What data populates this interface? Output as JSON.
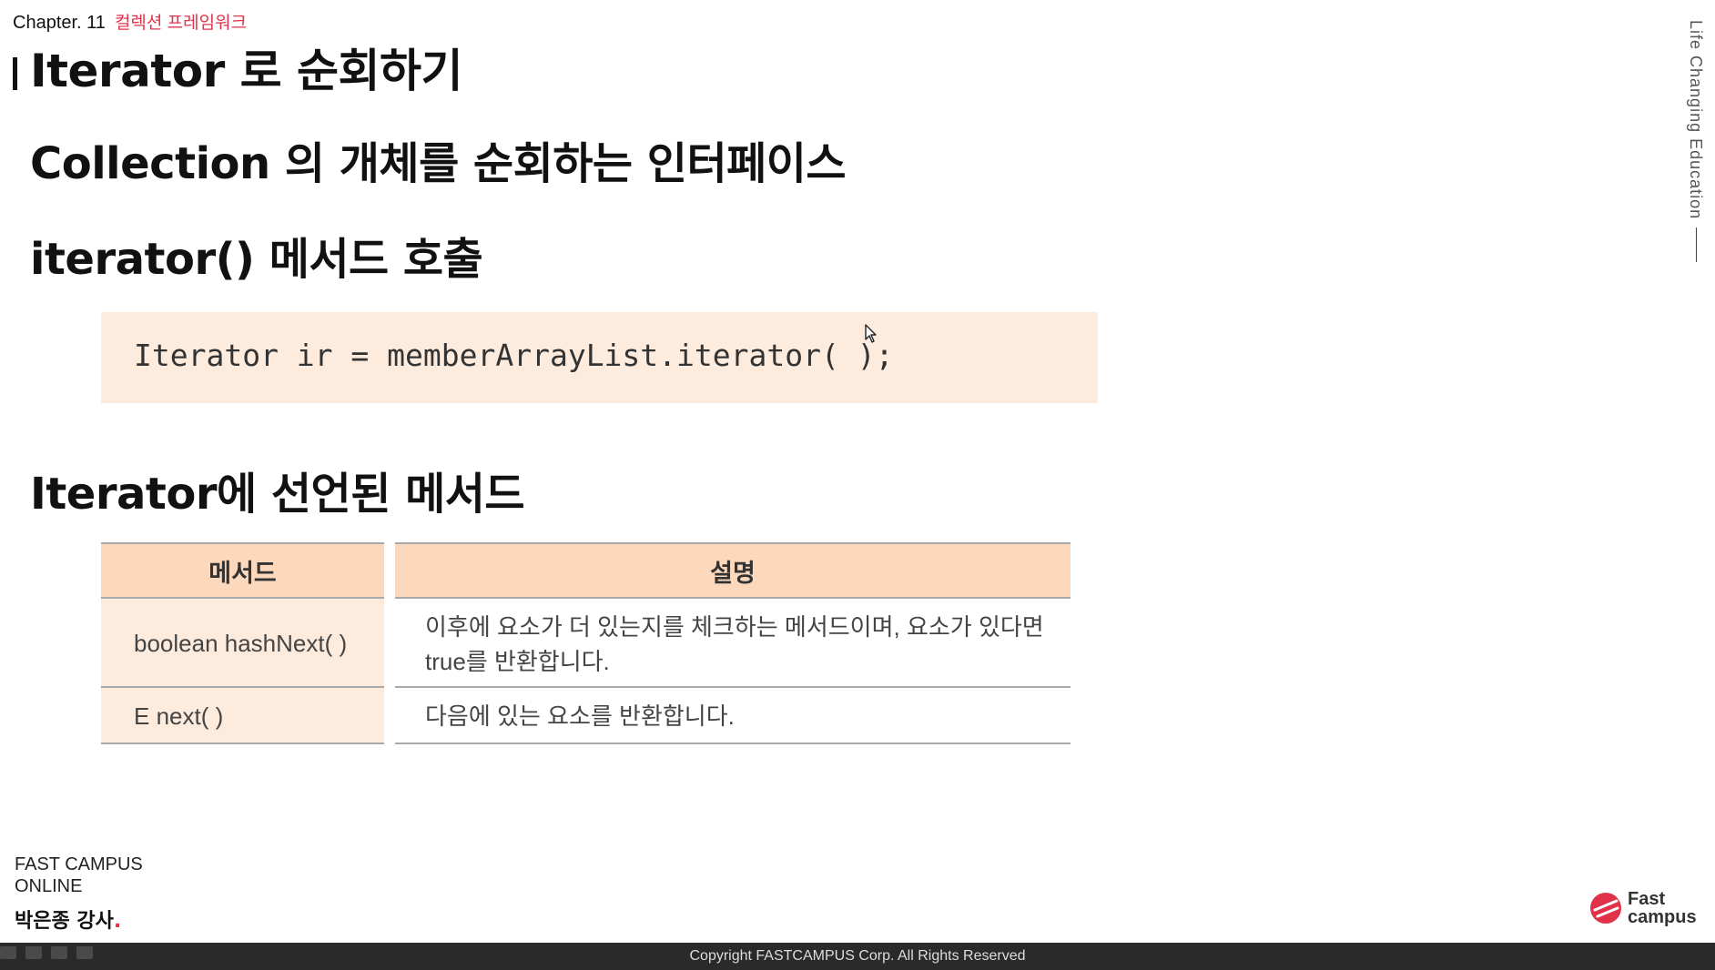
{
  "header": {
    "chapter": "Chapter. 11",
    "chapter_sub": "컬렉션 프레임워크"
  },
  "title": "Iterator 로 순회하기",
  "bullets": [
    "Collection 의 개체를 순회하는 인터페이스",
    "iterator() 메서드 호출",
    "Iterator에 선언된 메서드"
  ],
  "code": "Iterator ir = memberArrayList.iterator( );",
  "table": {
    "headers": [
      "메서드",
      "설명"
    ],
    "rows": [
      {
        "method": "boolean hashNext( )",
        "desc_line1": "이후에 요소가 더 있는지를 체크하는 메서드이며, 요소가 있다면",
        "desc_line2": "true를 반환합니다."
      },
      {
        "method": "E next( )",
        "desc_line1": "다음에 있는 요소를 반환합니다."
      }
    ]
  },
  "side_text": "Life Changing Education",
  "footer": {
    "brand_line1": "FAST CAMPUS",
    "brand_line2": "ONLINE",
    "instructor": "박은종 강사",
    "instructor_dot": ".",
    "logo_line1": "Fast",
    "logo_line2": "campus",
    "copyright": "Copyright FASTCAMPUS Corp. All Rights Reserved"
  },
  "colors": {
    "accent": "#e0334a",
    "code_bg": "#fdebdd",
    "table_header_bg": "#fcd9bd",
    "bottom_bar": "#2a2a2a"
  }
}
